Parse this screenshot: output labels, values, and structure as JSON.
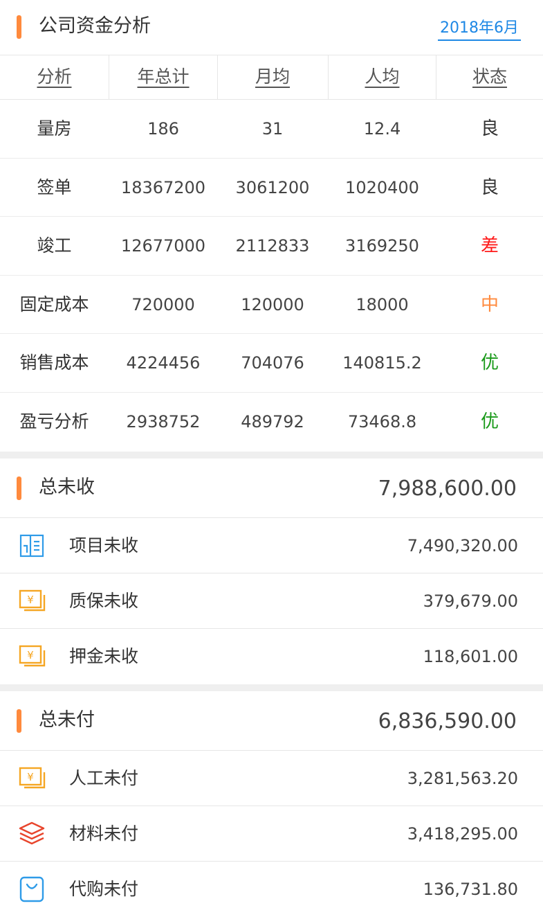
{
  "header": {
    "title": "公司资金分析",
    "date": "2018年6月"
  },
  "table": {
    "columns": [
      "分析",
      "年总计",
      "月均",
      "人均",
      "状态"
    ],
    "rows": [
      {
        "label": "量房",
        "total": "186",
        "monthly": "31",
        "per_person": "12.4",
        "status": "良",
        "status_color": "#333333"
      },
      {
        "label": "签单",
        "total": "18367200",
        "monthly": "3061200",
        "per_person": "1020400",
        "status": "良",
        "status_color": "#333333"
      },
      {
        "label": "竣工",
        "total": "12677000",
        "monthly": "2112833",
        "per_person": "3169250",
        "status": "差",
        "status_color": "#ff1a1a"
      },
      {
        "label": "固定成本",
        "total": "720000",
        "monthly": "120000",
        "per_person": "18000",
        "status": "中",
        "status_color": "#ff8a3d"
      },
      {
        "label": "销售成本",
        "total": "4224456",
        "monthly": "704076",
        "per_person": "140815.2",
        "status": "优",
        "status_color": "#1a9a1a"
      },
      {
        "label": "盈亏分析",
        "total": "2938752",
        "monthly": "489792",
        "per_person": "73468.8",
        "status": "优",
        "status_color": "#1a9a1a"
      }
    ]
  },
  "receivable": {
    "title": "总未收",
    "total": "7,988,600.00",
    "items": [
      {
        "label": "项目未收",
        "amount": "7,490,320.00",
        "icon": "project-document-icon"
      },
      {
        "label": "质保未收",
        "amount": "379,679.00",
        "icon": "yuan-bill-icon"
      },
      {
        "label": "押金未收",
        "amount": "118,601.00",
        "icon": "yuan-bill-icon"
      }
    ]
  },
  "payable": {
    "title": "总未付",
    "total": "6,836,590.00",
    "items": [
      {
        "label": "人工未付",
        "amount": "3,281,563.20",
        "icon": "yuan-bill-icon"
      },
      {
        "label": "材料未付",
        "amount": "3,418,295.00",
        "icon": "layers-icon"
      },
      {
        "label": "代购未付",
        "amount": "136,731.80",
        "icon": "shopping-bag-icon"
      }
    ]
  },
  "colors": {
    "accent_bar": "#ff8a3d",
    "date_link": "#1e88e5",
    "icon_blue": "#2e9be8",
    "icon_orange": "#f5a623",
    "icon_red": "#e8452c"
  }
}
